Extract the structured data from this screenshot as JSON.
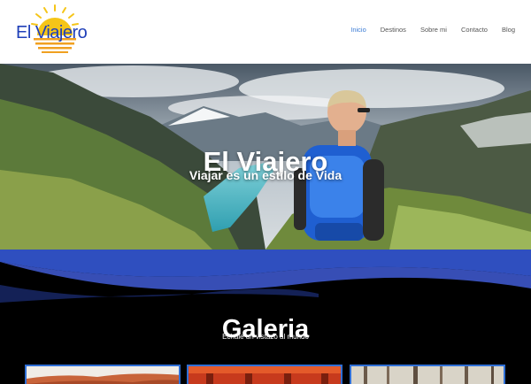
{
  "site": {
    "logo_text": "El Viajero"
  },
  "nav": {
    "items": [
      {
        "label": "Inicio",
        "active": true
      },
      {
        "label": "Destinos",
        "active": false
      },
      {
        "label": "Sobre mi",
        "active": false
      },
      {
        "label": "Contacto",
        "active": false
      },
      {
        "label": "Blog",
        "active": false
      }
    ]
  },
  "hero": {
    "title": "El Viajero",
    "subtitle": "Viajar es un estilo de Vida"
  },
  "gallery": {
    "title": "Galeria",
    "subtitle": "Echale un vistazo al mundo",
    "thumbnails": [
      {
        "name": "gallery-thumb-desert"
      },
      {
        "name": "gallery-thumb-torii"
      },
      {
        "name": "gallery-thumb-forest"
      }
    ]
  },
  "colors": {
    "brand_blue": "#1f3fb8",
    "nav_active": "#3a7bd5",
    "sun_yellow": "#f5c518",
    "wave_blue": "#2f4fbf",
    "thumb_border": "#2f6fd6"
  }
}
